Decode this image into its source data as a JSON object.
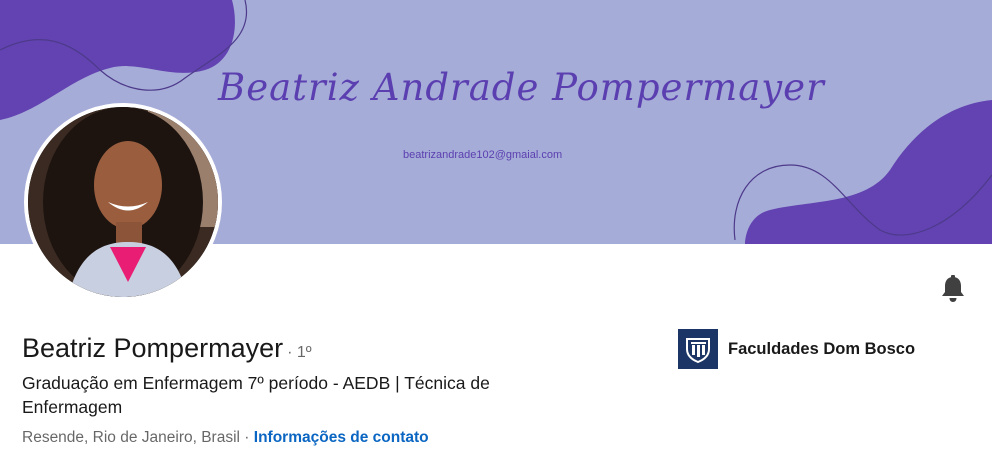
{
  "banner": {
    "name": "Beatriz Andrade Pompermayer",
    "email": "beatrizandrade102@gmaial.com",
    "colors": {
      "background": "#a6acd8",
      "blob": "#6243b1",
      "line": "#4d3a8a"
    }
  },
  "profile": {
    "name": "Beatriz Pompermayer",
    "degree": "· 1º",
    "headline": "Graduação em Enfermagem 7º período - AEDB | Técnica de Enfermagem",
    "location": "Resende, Rio de Janeiro, Brasil",
    "separator": " · ",
    "contact_link": "Informações de contato"
  },
  "education": {
    "name": "Faculdades Dom Bosco",
    "logo_icon": "dom-bosco-logo-icon"
  },
  "icons": {
    "bell": "bell-icon"
  },
  "colors": {
    "link": "#0a66c2",
    "text": "#191919",
    "muted": "#666666"
  }
}
